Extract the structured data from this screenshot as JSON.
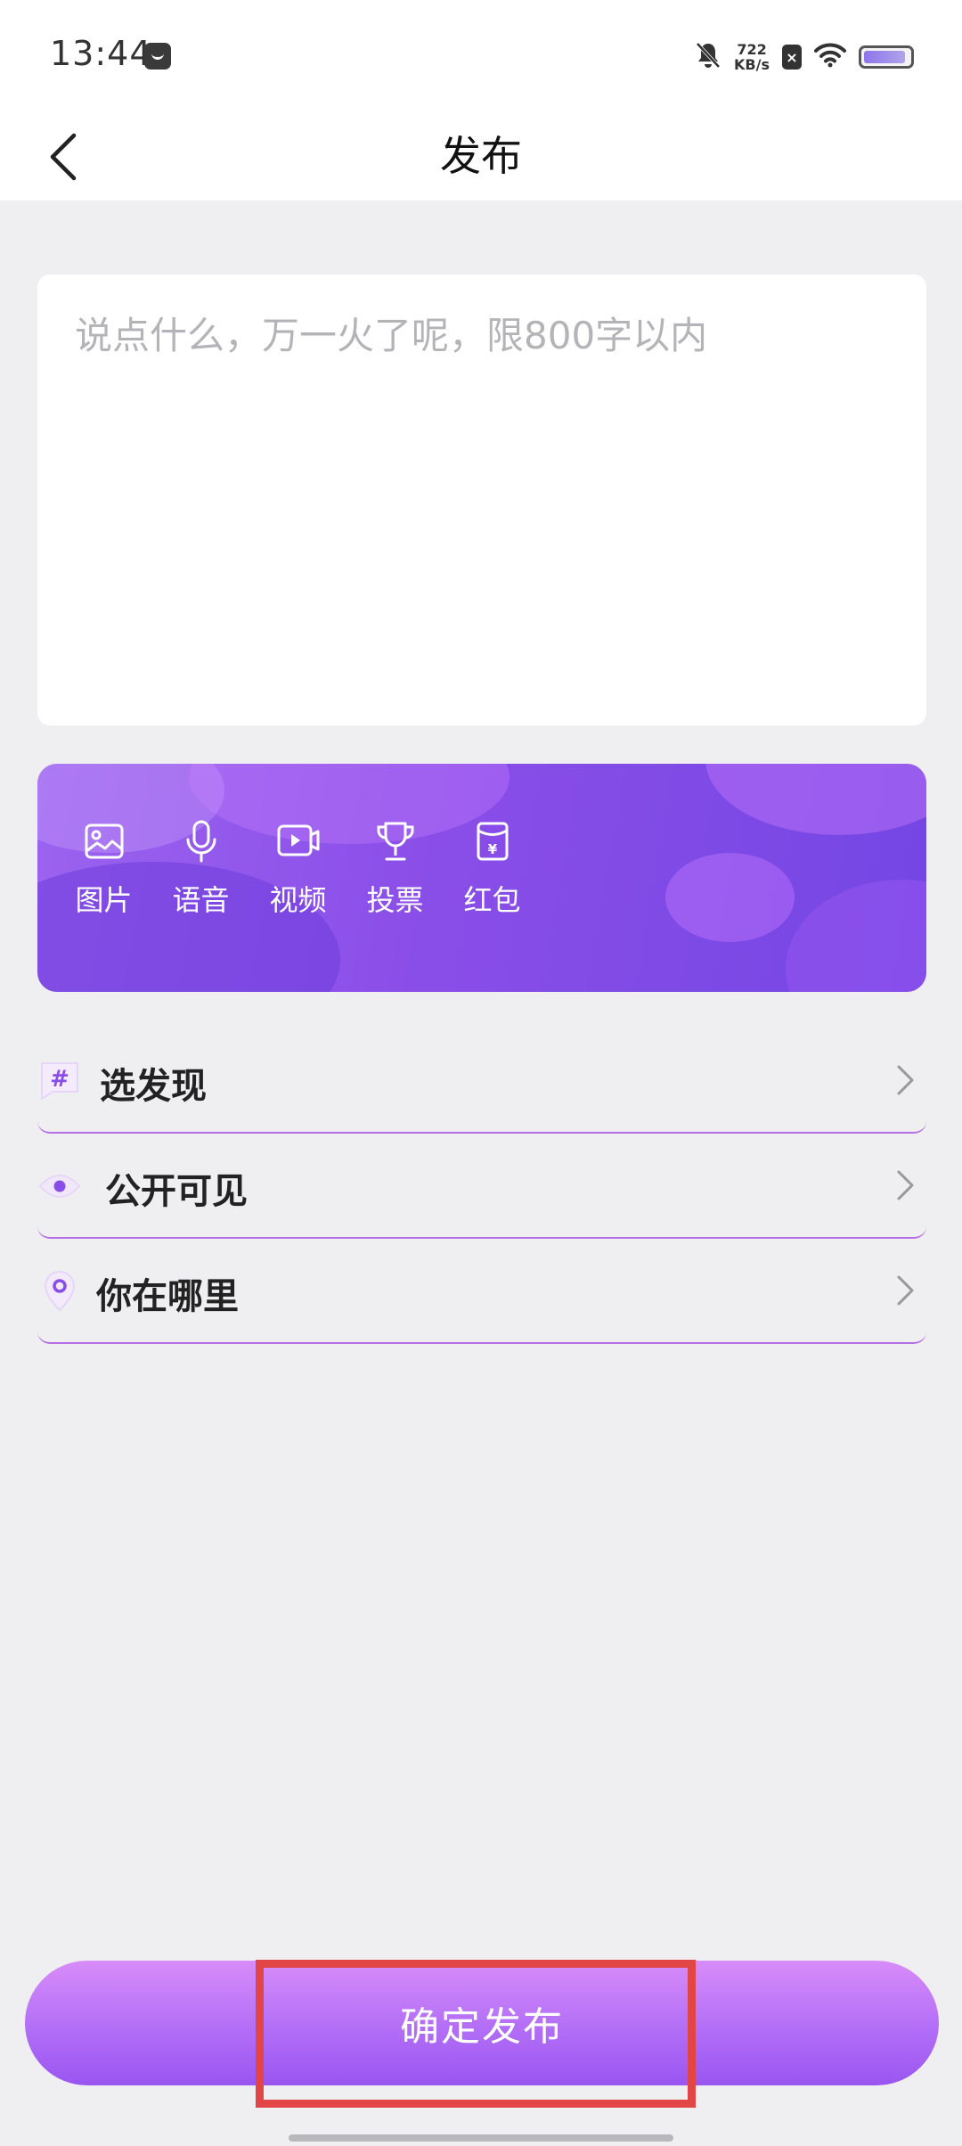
{
  "status_bar": {
    "time": "13:44",
    "net_speed_value": "722",
    "net_speed_unit": "KB/s"
  },
  "header": {
    "title": "发布"
  },
  "post": {
    "placeholder": "说点什么，万一火了呢，限800字以内"
  },
  "toolbar": {
    "items": [
      {
        "label": "图片",
        "icon": "image-icon"
      },
      {
        "label": "语音",
        "icon": "microphone-icon"
      },
      {
        "label": "视频",
        "icon": "video-icon"
      },
      {
        "label": "投票",
        "icon": "trophy-icon"
      },
      {
        "label": "红包",
        "icon": "red-envelope-icon"
      }
    ]
  },
  "options": {
    "items": [
      {
        "label": "选发现",
        "icon": "hashtag-icon"
      },
      {
        "label": "公开可见",
        "icon": "eye-icon"
      },
      {
        "label": "你在哪里",
        "icon": "location-pin-icon"
      }
    ]
  },
  "submit": {
    "label": "确定发布"
  },
  "colors": {
    "accent": "#8a4ee8",
    "highlight": "#e24545",
    "background": "#efeff1"
  }
}
